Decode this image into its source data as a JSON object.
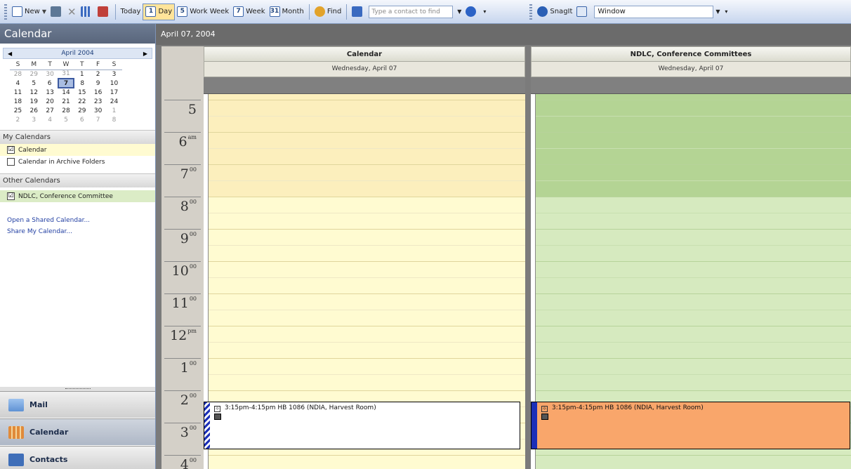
{
  "toolbar": {
    "new_label": "New",
    "today_label": "Today",
    "day_label": "Day",
    "day_icon": "1",
    "work_week_label": "Work Week",
    "work_week_icon": "5",
    "week_label": "Week",
    "week_icon": "7",
    "month_label": "Month",
    "month_icon": "31",
    "find_label": "Find",
    "contact_search_placeholder": "Type a contact to find",
    "snagit_label": "SnagIt",
    "snagit_window_value": "Window"
  },
  "nav": {
    "title": "Calendar",
    "mini_calendar": {
      "month_label": "April 2004",
      "weekdays": [
        "S",
        "M",
        "T",
        "W",
        "T",
        "F",
        "S"
      ],
      "weeks": [
        [
          "28",
          "29",
          "30",
          "31",
          "1",
          "2",
          "3"
        ],
        [
          "4",
          "5",
          "6",
          "7",
          "8",
          "9",
          "10"
        ],
        [
          "11",
          "12",
          "13",
          "14",
          "15",
          "16",
          "17"
        ],
        [
          "18",
          "19",
          "20",
          "21",
          "22",
          "23",
          "24"
        ],
        [
          "25",
          "26",
          "27",
          "28",
          "29",
          "30",
          "1"
        ],
        [
          "2",
          "3",
          "4",
          "5",
          "6",
          "7",
          "8"
        ]
      ],
      "selected_day": "7"
    },
    "my_calendars": {
      "label": "My Calendars",
      "items": [
        {
          "label": "Calendar",
          "checked": "☑"
        },
        {
          "label": "Calendar in Archive Folders",
          "checked": ""
        }
      ]
    },
    "other_calendars": {
      "label": "Other Calendars",
      "items": [
        {
          "label": "NDLC, Conference Committee",
          "checked": "☑"
        }
      ]
    },
    "links": {
      "open_shared": "Open a Shared Calendar...",
      "share_my": "Share My Calendar..."
    },
    "buttons": {
      "mail": "Mail",
      "calendar": "Calendar",
      "contacts": "Contacts"
    }
  },
  "main": {
    "date_header": "April 07, 2004",
    "time_labels": [
      {
        "hour": "5",
        "suffix": ""
      },
      {
        "hour": "6",
        "suffix": "am"
      },
      {
        "hour": "7",
        "suffix": "00"
      },
      {
        "hour": "8",
        "suffix": "00"
      },
      {
        "hour": "9",
        "suffix": "00"
      },
      {
        "hour": "10",
        "suffix": "00"
      },
      {
        "hour": "11",
        "suffix": "00"
      },
      {
        "hour": "12",
        "suffix": "pm"
      },
      {
        "hour": "1",
        "suffix": "00"
      },
      {
        "hour": "2",
        "suffix": "00"
      },
      {
        "hour": "3",
        "suffix": "00"
      },
      {
        "hour": "4",
        "suffix": "00"
      }
    ],
    "columns": [
      {
        "title": "Calendar",
        "date": "Wednesday, April 07",
        "color_offhours": "#fcefbd",
        "color_workhours": "#fffbd1",
        "appointment": {
          "text": "3:15pm-4:15pm HB 1086 (NDIA, Harvest Room)",
          "background": "#ffffff"
        }
      },
      {
        "title": "NDLC, Conference Committees",
        "date": "Wednesday, April 07",
        "color_offhours": "#b4d494",
        "color_workhours": "#d6eabf",
        "appointment": {
          "text": "3:15pm-4:15pm HB 1086 (NDIA, Harvest Room)",
          "background": "#f9a66b"
        }
      }
    ]
  }
}
